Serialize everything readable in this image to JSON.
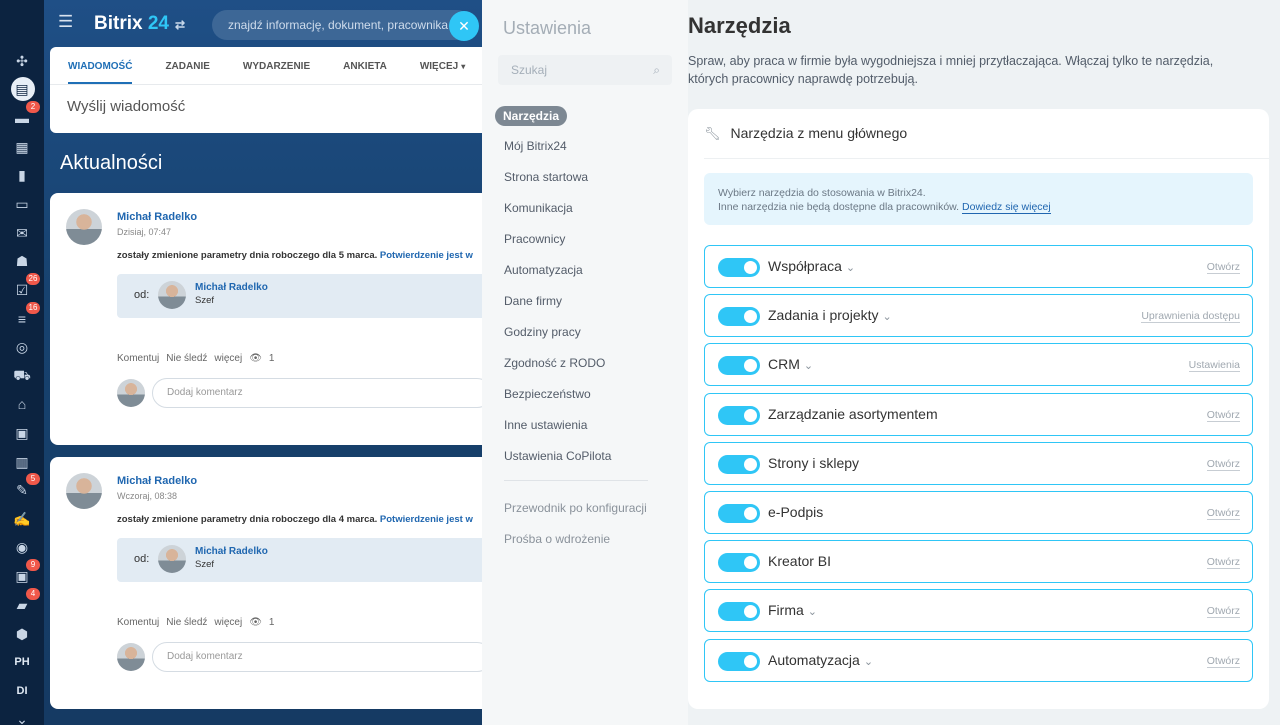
{
  "app": {
    "logo_main": "Bitrix",
    "logo_num": " 24",
    "search_placeholder": "znajdź informację, dokument, pracownika"
  },
  "sidebar_rail": {
    "items": [
      {
        "icon": "grid-icon",
        "glyph": "✣",
        "badge": ""
      },
      {
        "icon": "feed-icon",
        "glyph": "▤",
        "badge": "",
        "active": true
      },
      {
        "icon": "chat-icon",
        "glyph": "▬",
        "badge": "2"
      },
      {
        "icon": "calendar-icon",
        "glyph": "▦",
        "badge": ""
      },
      {
        "icon": "document-icon",
        "glyph": "▮",
        "badge": ""
      },
      {
        "icon": "drive-icon",
        "glyph": "▭",
        "badge": ""
      },
      {
        "icon": "mail-icon",
        "glyph": "✉",
        "badge": ""
      },
      {
        "icon": "groups-icon",
        "glyph": "☗",
        "badge": ""
      },
      {
        "icon": "tasks-icon",
        "glyph": "☑",
        "badge": "26"
      },
      {
        "icon": "crm-icon",
        "glyph": "≡",
        "badge": "16"
      },
      {
        "icon": "target-icon",
        "glyph": "◎",
        "badge": ""
      },
      {
        "icon": "cart-icon",
        "glyph": "⛟",
        "badge": ""
      },
      {
        "icon": "shop-icon",
        "glyph": "⌂",
        "badge": ""
      },
      {
        "icon": "inventory-icon",
        "glyph": "▣",
        "badge": ""
      },
      {
        "icon": "analytics-icon",
        "glyph": "▥",
        "badge": ""
      },
      {
        "icon": "sign-icon",
        "glyph": "✎",
        "badge": "5"
      },
      {
        "icon": "signature-icon",
        "glyph": "✍",
        "badge": ""
      },
      {
        "icon": "bi-icon",
        "glyph": "◉",
        "badge": ""
      },
      {
        "icon": "company-icon",
        "glyph": "▣",
        "badge": "9"
      },
      {
        "icon": "robot-icon",
        "glyph": "▰",
        "badge": "4"
      },
      {
        "icon": "box-icon",
        "glyph": "⬢",
        "badge": ""
      },
      {
        "icon": "text-ph",
        "text": "PH",
        "badge": ""
      },
      {
        "icon": "text-di",
        "text": "DI",
        "badge": ""
      },
      {
        "icon": "more-icon",
        "glyph": "⌄",
        "badge": ""
      }
    ]
  },
  "feed": {
    "tabs": [
      "WIADOMOŚĆ",
      "ZADANIE",
      "WYDARZENIE",
      "ANKIETA",
      "WIĘCEJ"
    ],
    "send_message": "Wyślij wiadomość",
    "title": "Aktualności",
    "posts": [
      {
        "author": "Michał Radelko",
        "date": "Dzisiaj, 07:47",
        "text": "zostały zmienione parametry dnia roboczego dla 5 marca. ",
        "link": "Potwierdzenie jest w",
        "from_label": "od:",
        "from_name": "Michał Radelko",
        "from_role": "Szef",
        "actions": [
          "Komentuj",
          "Nie śledź",
          "więcej"
        ],
        "views": "1",
        "comment_placeholder": "Dodaj komentarz"
      },
      {
        "author": "Michał Radelko",
        "date": "Wczoraj, 08:38",
        "text": "zostały zmienione parametry dnia roboczego dla 4 marca. ",
        "link": "Potwierdzenie jest w",
        "from_label": "od:",
        "from_name": "Michał Radelko",
        "from_role": "Szef",
        "actions": [
          "Komentuj",
          "Nie śledź",
          "więcej"
        ],
        "views": "1",
        "comment_placeholder": "Dodaj komentarz"
      }
    ]
  },
  "settings_nav": {
    "title": "Ustawienia",
    "search_placeholder": "Szukaj",
    "items": [
      "Narzędzia",
      "Mój Bitrix24",
      "Strona startowa",
      "Komunikacja",
      "Pracownicy",
      "Automatyzacja",
      "Dane firmy",
      "Godziny pracy",
      "Zgodność z RODO",
      "Bezpieczeństwo",
      "Inne ustawienia",
      "Ustawienia CoPilota"
    ],
    "secondary_items": [
      "Przewodnik po konfiguracji",
      "Prośba o wdrożenie"
    ]
  },
  "tools_page": {
    "title": "Narzędzia",
    "description": "Spraw, aby praca w firmie była wygodniejsza i mniej przytłaczająca. Włączaj tylko te narzędzia, których pracownicy naprawdę potrzebują.",
    "section_title": "Narzędzia z menu głównego",
    "info_line1": "Wybierz narzędzia do stosowania w Bitrix24.",
    "info_line2": "Inne narzędzia nie będą dostępne dla pracowników. ",
    "info_link": "Dowiedz się więcej",
    "tools": [
      {
        "name": "Współpraca",
        "expand": true,
        "action": "Otwórz",
        "enabled": true
      },
      {
        "name": "Zadania i projekty",
        "expand": true,
        "action": "Uprawnienia dostępu",
        "enabled": true
      },
      {
        "name": "CRM",
        "expand": true,
        "action": "Ustawienia",
        "enabled": true
      },
      {
        "name": "Zarządzanie asortymentem",
        "expand": false,
        "action": "Otwórz",
        "enabled": true
      },
      {
        "name": "Strony i sklepy",
        "expand": false,
        "action": "Otwórz",
        "enabled": true
      },
      {
        "name": "e-Podpis",
        "expand": false,
        "action": "Otwórz",
        "enabled": true
      },
      {
        "name": "Kreator BI",
        "expand": false,
        "action": "Otwórz",
        "enabled": true
      },
      {
        "name": "Firma",
        "expand": true,
        "action": "Otwórz",
        "enabled": true
      },
      {
        "name": "Automatyzacja",
        "expand": true,
        "action": "Otwórz",
        "enabled": true
      }
    ]
  }
}
